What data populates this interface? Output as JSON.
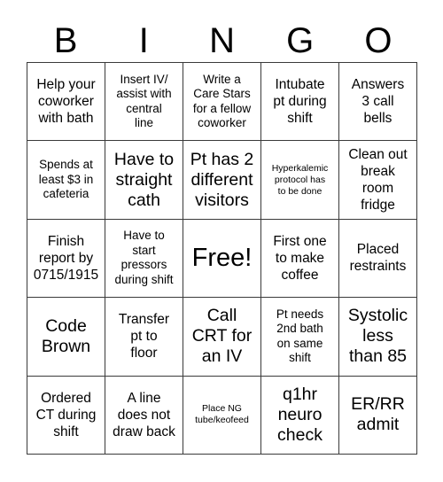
{
  "card": {
    "title": "BINGO",
    "header_letters": [
      "B",
      "I",
      "N",
      "G",
      "O"
    ],
    "colors": {
      "background": "#ffffff",
      "text": "#000000",
      "grid_line": "#3a3a3a"
    },
    "grid": {
      "columns": 5,
      "rows": 5,
      "free_space": "Free!"
    },
    "cells": [
      {
        "text": "Help your\ncoworker\nwith bath",
        "size": "md",
        "row": 1,
        "col": 1
      },
      {
        "text": "Insert IV/\nassist with\ncentral\nline",
        "size": "sm",
        "row": 1,
        "col": 2
      },
      {
        "text": "Write a\nCare Stars\nfor a fellow\ncoworker",
        "size": "sm",
        "row": 1,
        "col": 3
      },
      {
        "text": "Intubate\npt during\nshift",
        "size": "md",
        "row": 1,
        "col": 4
      },
      {
        "text": "Answers\n3 call\nbells",
        "size": "md",
        "row": 1,
        "col": 5
      },
      {
        "text": "Spends at\nleast $3 in\ncafeteria",
        "size": "sm",
        "row": 2,
        "col": 1
      },
      {
        "text": "Have to\nstraight\ncath",
        "size": "lg",
        "row": 2,
        "col": 2
      },
      {
        "text": "Pt has 2\ndifferent\nvisitors",
        "size": "lg",
        "row": 2,
        "col": 3
      },
      {
        "text": "Hyperkalemic\nprotocol has\nto be done",
        "size": "xs",
        "row": 2,
        "col": 4
      },
      {
        "text": "Clean out\nbreak\nroom\nfridge",
        "size": "md",
        "row": 2,
        "col": 5
      },
      {
        "text": "Finish\nreport by\n0715/1915",
        "size": "md",
        "row": 3,
        "col": 1
      },
      {
        "text": "Have to\nstart\npressors\nduring shift",
        "size": "sm",
        "row": 3,
        "col": 2
      },
      {
        "text": "Free!",
        "size": "xl",
        "row": 3,
        "col": 3
      },
      {
        "text": "First one\nto make\ncoffee",
        "size": "md",
        "row": 3,
        "col": 4
      },
      {
        "text": "Placed\nrestraints",
        "size": "md",
        "row": 3,
        "col": 5
      },
      {
        "text": "Code\nBrown",
        "size": "lg",
        "row": 4,
        "col": 1
      },
      {
        "text": "Transfer\npt to\nfloor",
        "size": "md",
        "row": 4,
        "col": 2
      },
      {
        "text": "Call\nCRT for\nan IV",
        "size": "lg",
        "row": 4,
        "col": 3
      },
      {
        "text": "Pt needs\n2nd bath\non same\nshift",
        "size": "sm",
        "row": 4,
        "col": 4
      },
      {
        "text": "Systolic\nless\nthan 85",
        "size": "lg",
        "row": 4,
        "col": 5
      },
      {
        "text": "Ordered\nCT during\nshift",
        "size": "md",
        "row": 5,
        "col": 1
      },
      {
        "text": "A line\ndoes not\ndraw back",
        "size": "md",
        "row": 5,
        "col": 2
      },
      {
        "text": "Place NG\ntube/keofeed",
        "size": "xs",
        "row": 5,
        "col": 3
      },
      {
        "text": "q1hr\nneuro\ncheck",
        "size": "lg",
        "row": 5,
        "col": 4
      },
      {
        "text": "ER/RR\nadmit",
        "size": "lg",
        "row": 5,
        "col": 5
      }
    ]
  }
}
